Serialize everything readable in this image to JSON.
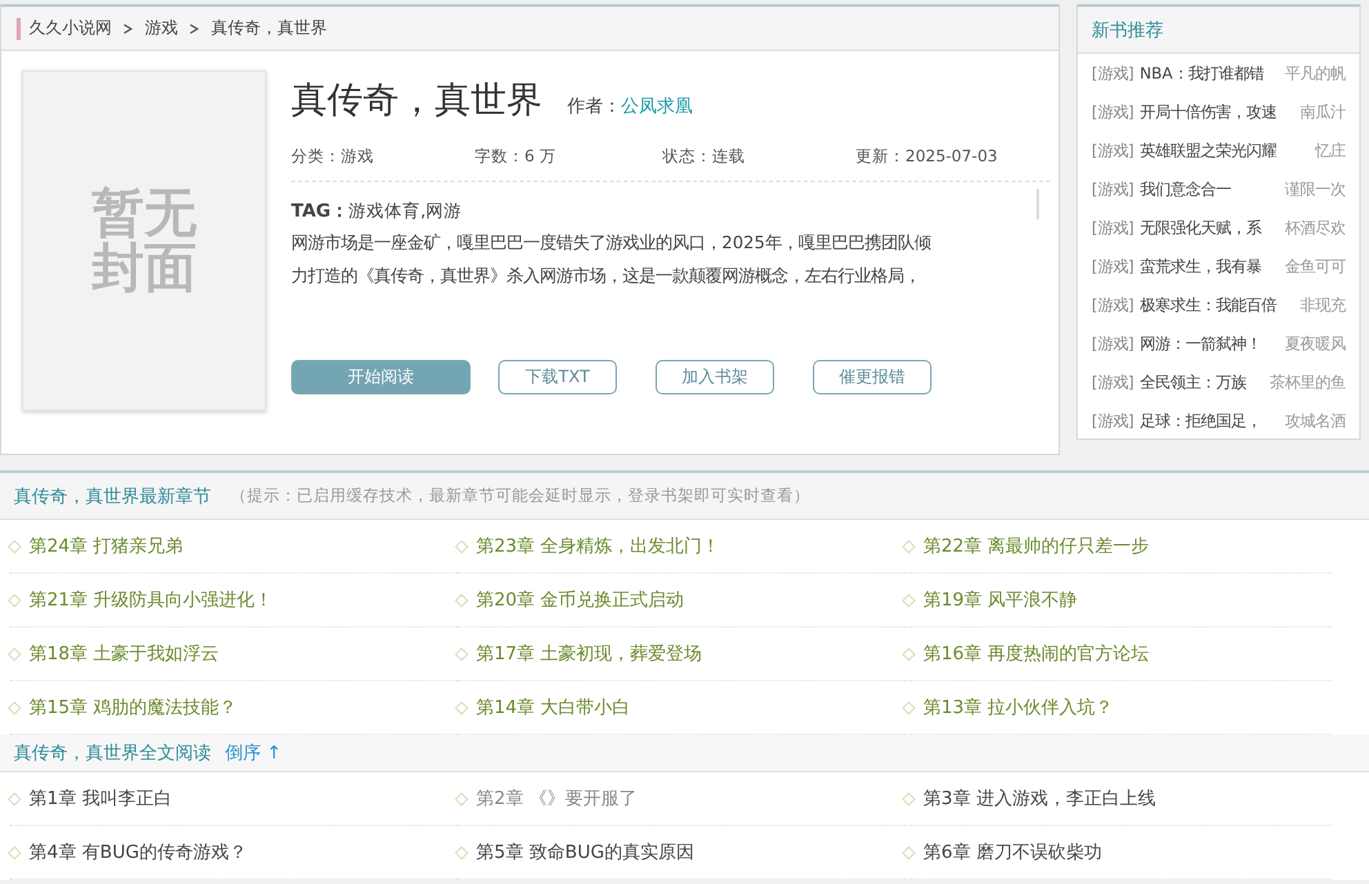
{
  "breadcrumb": [
    "久久小说网",
    "游戏",
    "真传奇，真世界"
  ],
  "book": {
    "cover_text": "暂无封面",
    "title": "真传奇，真世界",
    "author_label": "作者：",
    "author": "公凤求凰",
    "meta": [
      {
        "label": "分类：",
        "value": "游戏"
      },
      {
        "label": "字数：",
        "value": "6 万"
      },
      {
        "label": "状态：",
        "value": "连载"
      },
      {
        "label": "更新：",
        "value": "2025-07-03"
      }
    ],
    "tag_label": "TAG：",
    "tags": "游戏体育,网游",
    "description": [
      "网游市场是一座金矿，嘎里巴巴一度错失了游戏业的风口，2025年，嘎里巴巴携团队倾",
      "力打造的《真传奇，真世界》杀入网游市场，这是一款颠覆网游概念，左右行业格局，"
    ],
    "buttons": [
      {
        "label": "开始阅读",
        "kind": "primary"
      },
      {
        "label": "下载TXT",
        "kind": "outline"
      },
      {
        "label": "加入书架",
        "kind": "outline"
      },
      {
        "label": "催更报错",
        "kind": "outline"
      }
    ]
  },
  "recommend": {
    "title": "新书推荐",
    "items": [
      {
        "category": "[游戏]",
        "title": "NBA：我打谁都错",
        "author": "平凡的帆"
      },
      {
        "category": "[游戏]",
        "title": "开局十倍伤害，攻速",
        "author": "南瓜汁"
      },
      {
        "category": "[游戏]",
        "title": "英雄联盟之荣光闪耀",
        "author": "忆庄"
      },
      {
        "category": "[游戏]",
        "title": "我们意念合一",
        "author": "谨限一次"
      },
      {
        "category": "[游戏]",
        "title": "无限强化天赋，系",
        "author": "杯酒尽欢"
      },
      {
        "category": "[游戏]",
        "title": "蛮荒求生，我有暴",
        "author": "金鱼可可"
      },
      {
        "category": "[游戏]",
        "title": "极寒求生：我能百倍",
        "author": "非现充"
      },
      {
        "category": "[游戏]",
        "title": "网游：一箭弑神！",
        "author": "夏夜暖风"
      },
      {
        "category": "[游戏]",
        "title": "全民领主：万族",
        "author": "茶杯里的鱼"
      },
      {
        "category": "[游戏]",
        "title": "足球：拒绝国足，",
        "author": "攻城名酒"
      }
    ]
  },
  "latest": {
    "title": "真传奇，真世界最新章节",
    "hint": "（提示：已启用缓存技术，最新章节可能会延时显示，登录书架即可实时查看）",
    "chapters": [
      "第24章 打猪亲兄弟",
      "第23章 全身精炼，出发北门！",
      "第22章 离最帅的仔只差一步",
      "第21章 升级防具向小强进化！",
      "第20章 金币兑换正式启动",
      "第19章 风平浪不静",
      "第18章 土豪于我如浮云",
      "第17章 土豪初现，葬爱登场",
      "第16章 再度热闹的官方论坛",
      "第15章 鸡肋的魔法技能？",
      "第14章 大白带小白",
      "第13章 拉小伙伴入坑？"
    ]
  },
  "full": {
    "title": "真传奇，真世界全文阅读",
    "sort_label": "倒序",
    "sort_arrow": "↑",
    "chapters": [
      {
        "label": "第1章 我叫李正白",
        "visited": false
      },
      {
        "label": "第2章 《》要开服了",
        "visited": true
      },
      {
        "label": "第3章 进入游戏，李正白上线",
        "visited": false
      },
      {
        "label": "第4章 有BUG的传奇游戏？",
        "visited": false
      },
      {
        "label": "第5章 致命BUG的真实原因",
        "visited": false
      },
      {
        "label": "第6章 磨刀不误砍柴功",
        "visited": false
      }
    ]
  }
}
